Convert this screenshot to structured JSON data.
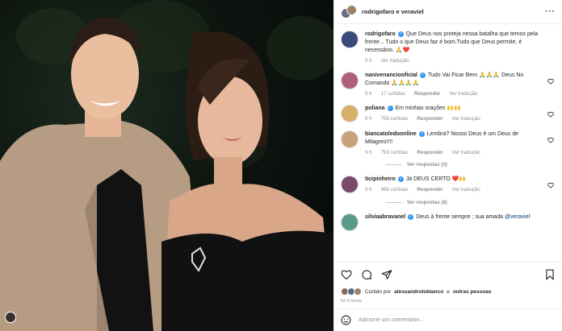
{
  "post": {
    "authors": "rodrigofaro e veraviel",
    "caption_user": "rodrigofaro",
    "caption_text": "Que Deus nos proteja nessa batalha que temos pela frente... Tudo o que Deus faz é bom.Tudo que Deus permite, é necessário. 🙏❤️",
    "caption_time": "9 h",
    "caption_translate": "Ver tradução"
  },
  "comments": [
    {
      "user": "nanivenanciooficial",
      "verified": true,
      "text": "Tudo Vai Ficar Bem 🙏🙏🙏 Deus No Comando 🙏🙏🙏🙏",
      "time": "9 h",
      "likes": "17 curtidas",
      "reply": "Responder",
      "translate": "Ver tradução",
      "avatar_color": "#b0607a"
    },
    {
      "user": "poliana",
      "verified": true,
      "text": "Em minhas orações 🙌🙌",
      "time": "9 h",
      "likes": "756 curtidas",
      "reply": "Responder",
      "translate": "Ver tradução",
      "avatar_color": "#d8b06a"
    },
    {
      "user": "biancatoledoonline",
      "verified": true,
      "text": "Lembra? Nosso Deus é um Deus de Milagres!!!!",
      "time": "9 h",
      "likes": "793 curtidas",
      "reply": "Responder",
      "translate": "Ver tradução",
      "avatar_color": "#c9a27a",
      "replies": "Ver respostas (3)"
    },
    {
      "user": "ticipinheiro",
      "verified": true,
      "text": "Já DEUS CERTO ❤️🙌",
      "time": "9 h",
      "likes": "986 curtidas",
      "reply": "Responder",
      "translate": "Ver tradução",
      "avatar_color": "#7a4a6a",
      "replies": "Ver respostas (8)"
    },
    {
      "user": "silviaabravanel",
      "verified": true,
      "text": "Deus à frente sempre ; sua amada",
      "mention": "@veraviel",
      "avatar_color": "#5a9a8a"
    }
  ],
  "likes_line": {
    "prefix": "Curtido por",
    "user": "alessandrolobianco",
    "joiner": "e",
    "others": "outras pessoas"
  },
  "post_time": "há 9 horas",
  "comment_input": {
    "placeholder": "Adicione um comentário..."
  },
  "colors": {
    "accent": "#3897f0",
    "heart_red": "#ed4956"
  },
  "icons": [
    "heart-icon",
    "comment-icon",
    "share-icon",
    "bookmark-icon",
    "emoji-icon",
    "more-icon",
    "verified-icon"
  ]
}
